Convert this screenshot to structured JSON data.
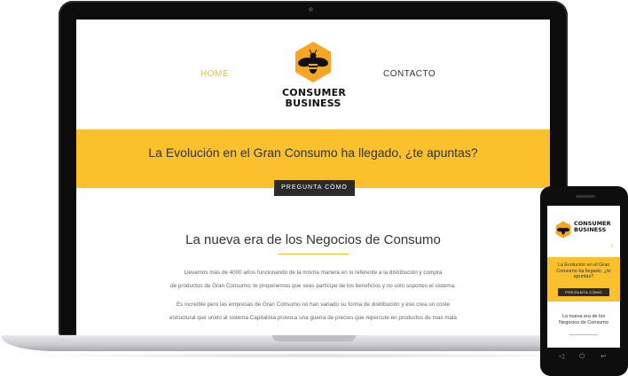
{
  "laptop_site": {
    "nav": {
      "home": "HOME",
      "contact": "CONTACTO"
    },
    "logo": {
      "line1": "CONSUMER",
      "line2": "BUSINESS",
      "icon": "bee-hexagon-icon"
    },
    "banner": {
      "headline": "La Evolución en el Gran Consumo ha llegado, ¿te apuntas?",
      "cta": "PREGUNTA CÓMO"
    },
    "section": {
      "title": "La nueva era de los Negocios de Consumo",
      "paragraph_lines": [
        "Llevamos más de 4000 años funcionando de la misma manera en lo referente a la distribución y compra",
        "de productos de Gran Consumo; te proponemos que seas partícipe de los beneficios y no solo soportes el sistema.",
        "Es increíble pero las empresas de Gran Consumo no han variado su forma de distribución y eso crea un coste",
        "estructural que unido al sistema Capitalista provoca una guerra de precios que repercute en productos de mas mala"
      ]
    }
  },
  "phone_site": {
    "logo": {
      "line1": "CONSUMER",
      "line2": "BUSINESS"
    },
    "menu_icon": "≡",
    "banner": {
      "headline": "La Evolución en el Gran Consumo ha llegado, ¿te apuntas?",
      "cta": "PREGUNTA CÓMO"
    },
    "section_title": "La nueva era de los Negocios de Consumo",
    "buttons": {
      "back": "◁",
      "home": "⏻",
      "menu": "↩"
    }
  },
  "colors": {
    "accent": "#fbc12d",
    "accent_text": "#f2bd2a",
    "dark": "#2b2b2b"
  }
}
